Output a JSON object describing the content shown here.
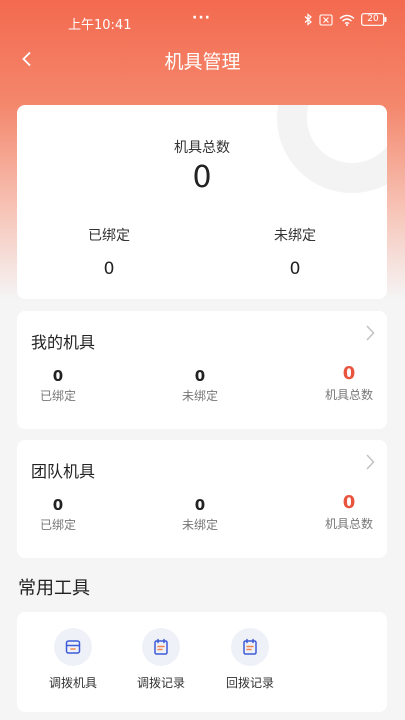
{
  "status_bar": {
    "time": "上午10:41",
    "dots": "···",
    "battery": "20"
  },
  "nav": {
    "title": "机具管理",
    "back_icon": "chevron-left-icon"
  },
  "summary": {
    "total_label": "机具总数",
    "total_value": "0",
    "bound_label": "已绑定",
    "bound_value": "0",
    "unbound_label": "未绑定",
    "unbound_value": "0"
  },
  "my_devices": {
    "title": "我的机具",
    "stats": [
      {
        "value": "0",
        "label": "已绑定"
      },
      {
        "value": "0",
        "label": "未绑定"
      },
      {
        "value": "0",
        "label": "机具总数"
      }
    ]
  },
  "team_devices": {
    "title": "团队机具",
    "stats": [
      {
        "value": "0",
        "label": "已绑定"
      },
      {
        "value": "0",
        "label": "未绑定"
      },
      {
        "value": "0",
        "label": "机具总数"
      }
    ]
  },
  "tools": {
    "title": "常用工具",
    "items": [
      {
        "label": "调拨机具",
        "icon": "box-icon"
      },
      {
        "label": "调拨记录",
        "icon": "record-icon"
      },
      {
        "label": "回拨记录",
        "icon": "record-icon"
      }
    ]
  },
  "colors": {
    "accent": "#f36a4f",
    "highlight_number": "#e8543e",
    "icon_blue": "#3d5bd6",
    "icon_orange": "#f0884e"
  }
}
